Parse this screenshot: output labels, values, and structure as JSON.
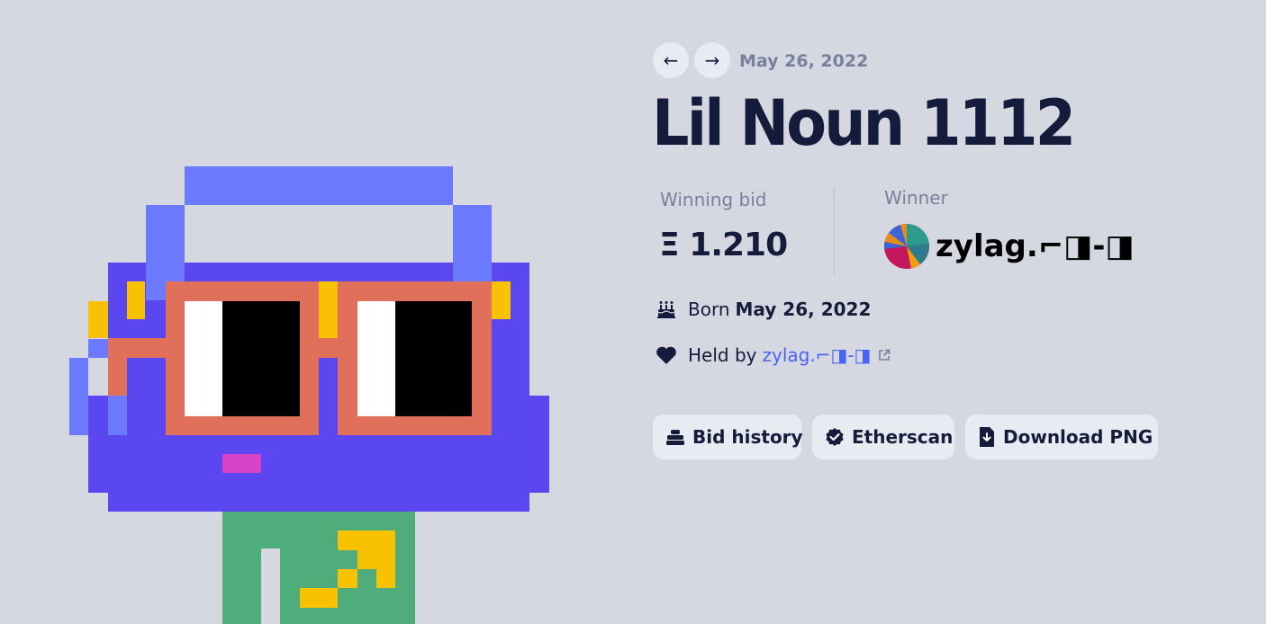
{
  "nav": {
    "prev_label": "←",
    "next_label": "→",
    "date": "May 26, 2022"
  },
  "title": "Lil Noun 1112",
  "stats": {
    "winning_bid_label": "Winning bid",
    "winning_bid_value": "Ξ 1.210",
    "winner_label": "Winner",
    "winner_name": "zylag.⌐◨-◨"
  },
  "born": {
    "label": "Born",
    "date": "May 26, 2022"
  },
  "held": {
    "label": "Held by",
    "owner": "zylag.⌐◨-◨"
  },
  "buttons": {
    "bid_history": "Bid history",
    "etherscan": "Etherscan",
    "download_png": "Download PNG"
  },
  "colors": {
    "background": "#d5d7e1",
    "accent_link": "#4965f0",
    "text_primary": "#151c3b",
    "text_muted": "#79809c",
    "noun_body": "#5a47f0",
    "noun_headphones": "#6b7afe",
    "noun_glasses": "#e0705a",
    "noun_yellow": "#f8c203",
    "noun_green": "#4fad7c",
    "noun_mouth": "#d743c8"
  },
  "icons": {
    "prev": "arrow-left-icon",
    "next": "arrow-right-icon",
    "born": "cake-icon",
    "held": "heart-icon",
    "external": "external-link-icon",
    "bid_history": "stack-icon",
    "etherscan": "verified-check-icon",
    "download": "file-download-icon"
  }
}
